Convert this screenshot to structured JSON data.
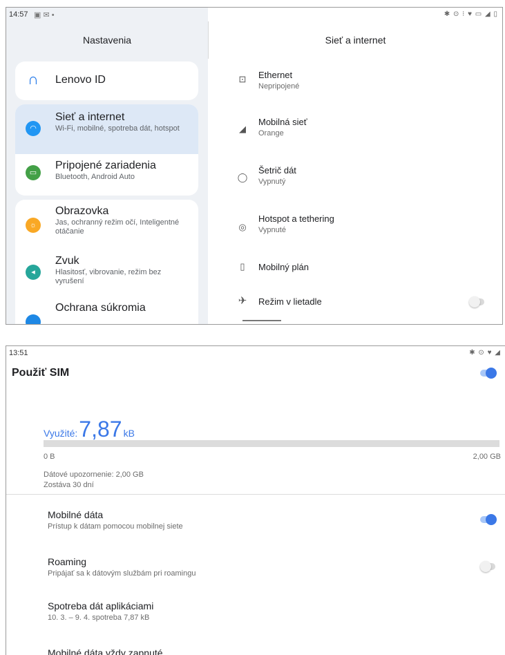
{
  "screen1": {
    "status": {
      "time": "14:57",
      "left_icons": "▣ ✉ •",
      "right_icons": "✱ ⊙ ⁝ ♥ ▭ ◢ ▯"
    },
    "left": {
      "header": "Nastavenia",
      "items": [
        {
          "title": "Lenovo ID",
          "subtitle": "",
          "icon": "account-icon",
          "color": "#1a73e8"
        },
        {
          "title": "Sieť a internet",
          "subtitle": "Wi-Fi, mobilné, spotreba dát, hotspot",
          "icon": "wifi-icon",
          "color": "#2196f3"
        },
        {
          "title": "Pripojené zariadenia",
          "subtitle": "Bluetooth, Android Auto",
          "icon": "devices-icon",
          "color": "#43a047"
        },
        {
          "title": "Obrazovka",
          "subtitle": "Jas, ochranný režim očí, Inteligentné otáčanie",
          "icon": "display-icon",
          "color": "#f9a825"
        },
        {
          "title": "Zvuk",
          "subtitle": "Hlasitosť, vibrovanie, režim bez vyrušení",
          "icon": "sound-icon",
          "color": "#26a69a"
        },
        {
          "title": "Ochrana súkromia",
          "subtitle": "",
          "icon": "privacy-icon",
          "color": "#1e88e5"
        }
      ]
    },
    "right": {
      "header": "Sieť a internet",
      "items": [
        {
          "title": "Ethernet",
          "subtitle": "Nepripojené",
          "icon": "ethernet-icon"
        },
        {
          "title": "Mobilná sieť",
          "subtitle": "Orange",
          "icon": "cell-signal-icon"
        },
        {
          "title": "Šetrič dát",
          "subtitle": "Vypnutý",
          "icon": "data-saver-icon"
        },
        {
          "title": "Hotspot a tethering",
          "subtitle": "Vypnuté",
          "icon": "hotspot-icon"
        },
        {
          "title": "Mobilný plán",
          "subtitle": "",
          "icon": "phone-icon"
        },
        {
          "title": "Režim v lietadle",
          "subtitle": "",
          "icon": "airplane-icon",
          "toggle": "off"
        }
      ]
    }
  },
  "screen2": {
    "status": {
      "time": "13:51",
      "right_icons": "✱ ⊙ ♥ ◢"
    },
    "title": "Použiť SIM",
    "use_sim_toggle": "on",
    "usage": {
      "label": "Využité:",
      "value": "7,87",
      "unit": "kB",
      "fraction": 0.0
    },
    "range_min": "0 B",
    "range_max": "2,00 GB",
    "warning": "Dátové upozornenie: 2,00 GB",
    "remaining": "Zostáva 30 dní",
    "items": [
      {
        "title": "Mobilné dáta",
        "subtitle": "Prístup k dátam pomocou mobilnej siete",
        "toggle": "on"
      },
      {
        "title": "Roaming",
        "subtitle": "Pripájať sa k dátovým službám pri roamingu",
        "toggle": "off"
      },
      {
        "title": "Spotreba dát aplikáciami",
        "subtitle": "10. 3. – 9. 4. spotreba 7,87 kB"
      },
      {
        "title": "Mobilné dáta vždy zapnuté",
        "subtitle": ""
      }
    ]
  }
}
